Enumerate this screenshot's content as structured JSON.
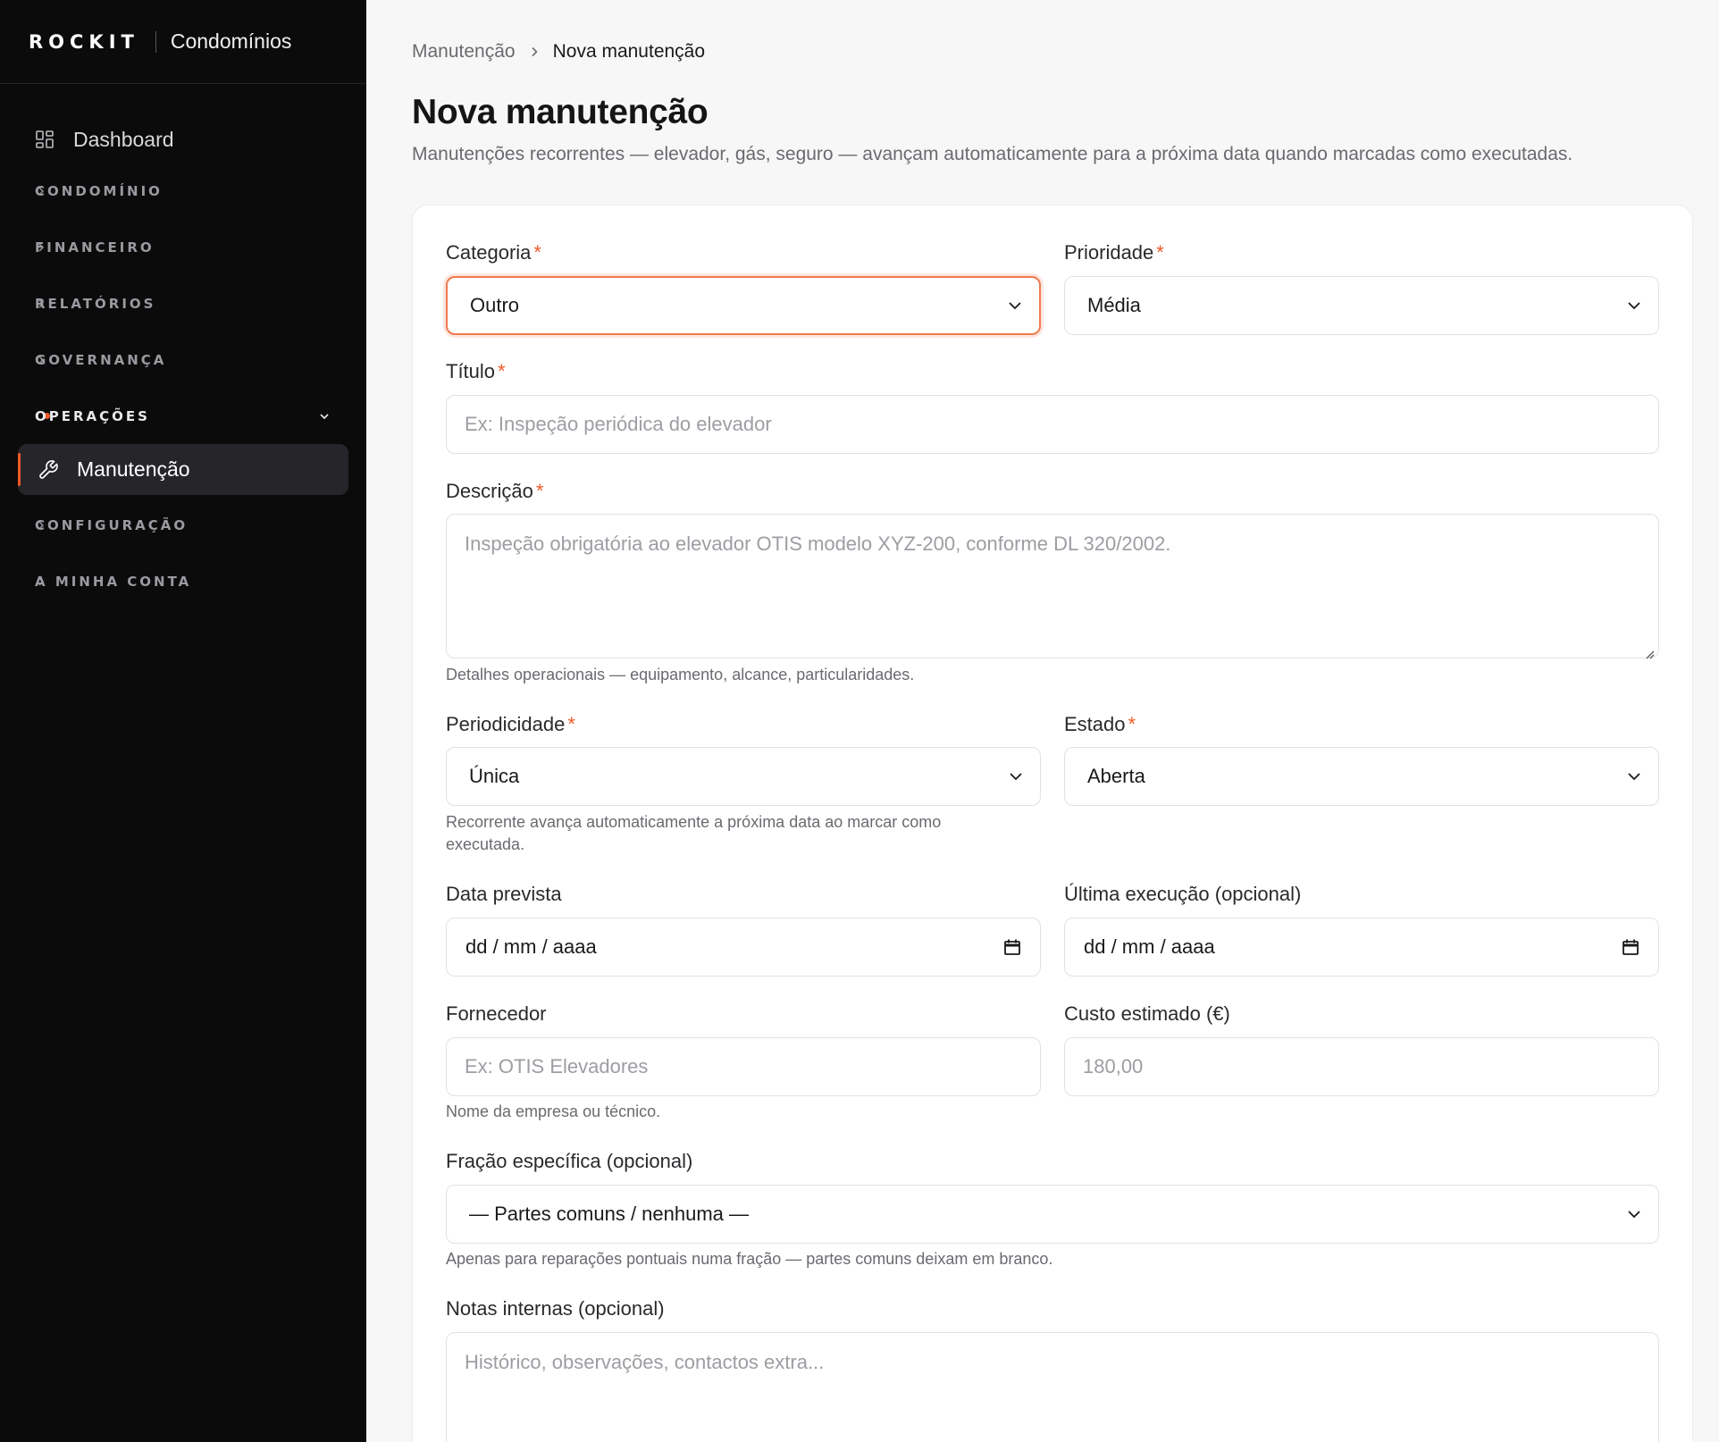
{
  "sidebar": {
    "brand_logo": "ROCKIT",
    "brand_name": "Condomínios",
    "dashboard_label": "Dashboard",
    "sections": [
      {
        "label": "CONDOMÍNIO"
      },
      {
        "label": "FINANCEIRO"
      },
      {
        "label": "RELATÓRIOS"
      },
      {
        "label": "GOVERNANÇA"
      },
      {
        "label": "OPERAÇÕES"
      },
      {
        "label": "CONFIGURAÇÃO"
      },
      {
        "label": "A MINHA CONTA"
      }
    ],
    "active_item": "Manutenção"
  },
  "breadcrumb": {
    "parent": "Manutenção",
    "current": "Nova manutenção"
  },
  "page": {
    "title": "Nova manutenção",
    "subtitle": "Manutenções recorrentes — elevador, gás, seguro — avançam automaticamente para a próxima data quando marcadas como executadas."
  },
  "form": {
    "categoria": {
      "label": "Categoria",
      "value": "Outro"
    },
    "prioridade": {
      "label": "Prioridade",
      "value": "Média"
    },
    "titulo": {
      "label": "Título",
      "placeholder": "Ex: Inspeção periódica do elevador"
    },
    "descricao": {
      "label": "Descrição",
      "placeholder": "Inspeção obrigatória ao elevador OTIS modelo XYZ-200, conforme DL 320/2002.",
      "hint": "Detalhes operacionais — equipamento, alcance, particularidades."
    },
    "periodicidade": {
      "label": "Periodicidade",
      "value": "Única",
      "hint": "Recorrente avança automaticamente a próxima data ao marcar como executada."
    },
    "estado": {
      "label": "Estado",
      "value": "Aberta"
    },
    "data_prevista": {
      "label": "Data prevista",
      "value": "dd / mm / aaaa"
    },
    "ultima_execucao": {
      "label": "Última execução (opcional)",
      "value": "dd / mm / aaaa"
    },
    "fornecedor": {
      "label": "Fornecedor",
      "placeholder": "Ex: OTIS Elevadores",
      "hint": "Nome da empresa ou técnico."
    },
    "custo": {
      "label": "Custo estimado (€)",
      "placeholder": "180,00"
    },
    "fracao": {
      "label": "Fração específica (opcional)",
      "value": "— Partes comuns / nenhuma —",
      "hint": "Apenas para reparações pontuais numa fração — partes comuns deixam em branco."
    },
    "notas": {
      "label": "Notas internas (opcional)",
      "placeholder": "Histórico, observações, contactos extra..."
    },
    "required_mark": "*"
  },
  "colors": {
    "accent": "#f05a28",
    "sidebar_bg": "#0b0b0c",
    "page_bg": "#f7f7f7"
  }
}
